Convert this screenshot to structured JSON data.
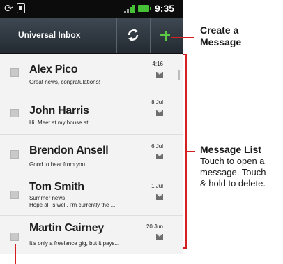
{
  "status_bar": {
    "time": "9:35",
    "sync_icon": "sync-icon",
    "sim_icon": "sim-icon",
    "signal_icon": "signal-icon",
    "battery_icon": "battery-icon"
  },
  "header": {
    "title": "Universal Inbox",
    "refresh_icon": "refresh-icon",
    "compose_icon": "plus-icon"
  },
  "messages": [
    {
      "sender": "Alex Pico",
      "preview": "Great news, congratulations!",
      "date": "4:16"
    },
    {
      "sender": "John Harris",
      "preview": "Hi. Meet at my house at...",
      "date": "8 Jul"
    },
    {
      "sender": "Brendon Ansell",
      "preview": "Good to hear from you...",
      "date": "6 Jul"
    },
    {
      "sender": "Tom Smith",
      "preview": "Summer news\nHope all is well. I'm currently the ...",
      "date": "1 Jul"
    },
    {
      "sender": "Martin Cairney",
      "preview": "It's only a freelance gig, but it pays...",
      "date": "20 Jun"
    }
  ],
  "callouts": {
    "create": {
      "title": "Create a\nMessage"
    },
    "list": {
      "title": "Message List",
      "body": "Touch to open a\nmessage. Touch\n& hold to delete."
    }
  },
  "colors": {
    "accent_green": "#5cc844",
    "callout_red": "#d42020",
    "header_dark": "#2c343b"
  }
}
